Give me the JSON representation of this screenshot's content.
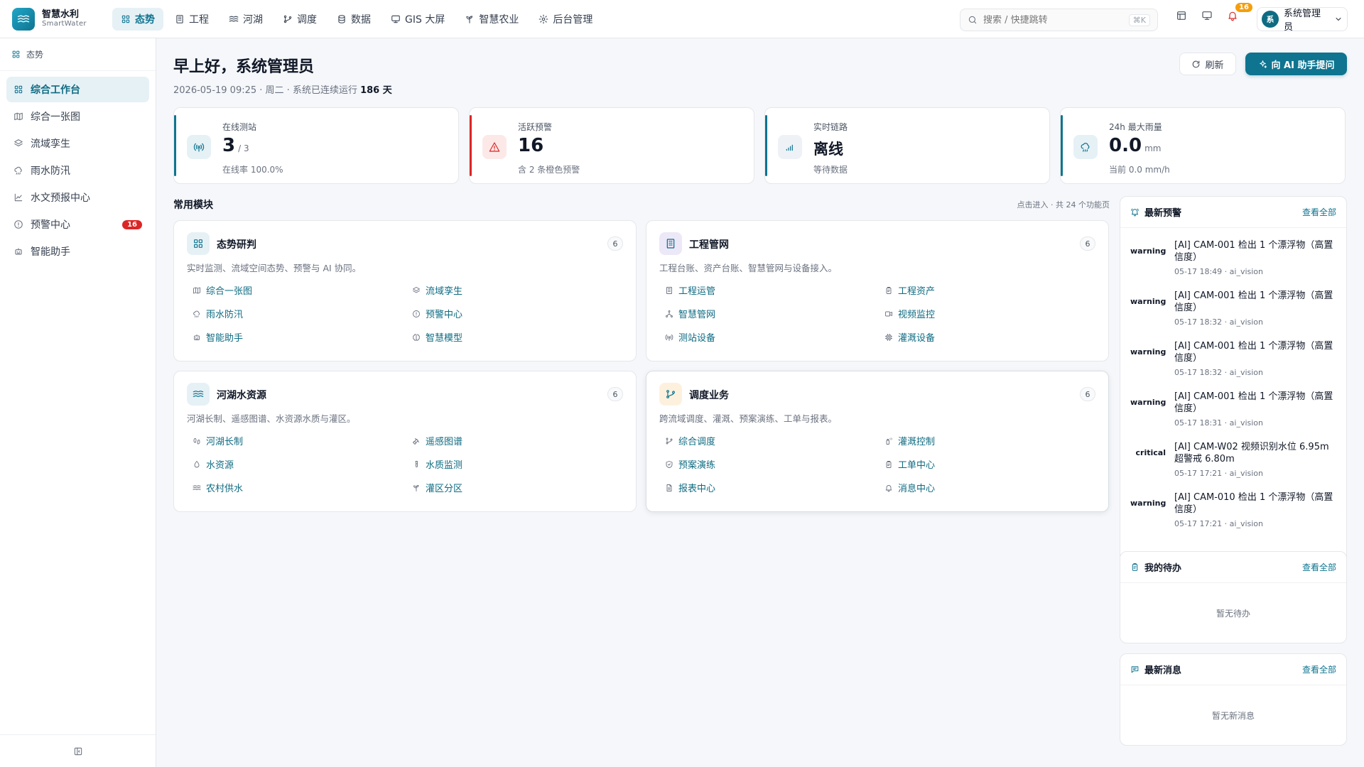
{
  "brand": {
    "name": "智慧水利",
    "sub": "SmartWater"
  },
  "nav": [
    {
      "label": "态势",
      "icon": "grid-icon",
      "active": true
    },
    {
      "label": "工程",
      "icon": "building-icon"
    },
    {
      "label": "河湖",
      "icon": "waves-icon"
    },
    {
      "label": "调度",
      "icon": "git-branch-icon"
    },
    {
      "label": "数据",
      "icon": "database-icon"
    },
    {
      "label": "GIS 大屏",
      "icon": "monitor-icon"
    },
    {
      "label": "智慧农业",
      "icon": "sprout-icon"
    },
    {
      "label": "后台管理",
      "icon": "gear-icon"
    }
  ],
  "search": {
    "placeholder": "搜索 / 快捷跳转",
    "shortcut": "⌘K"
  },
  "topbar": {
    "notification_count": "16",
    "user_avatar": "系",
    "user_name": "系统管理员"
  },
  "sidebar": {
    "header": "态势",
    "items": [
      {
        "label": "综合工作台",
        "icon": "grid-icon",
        "active": true
      },
      {
        "label": "综合一张图",
        "icon": "map-icon"
      },
      {
        "label": "流域孪生",
        "icon": "layers-icon"
      },
      {
        "label": "雨水防汛",
        "icon": "cloud-rain-icon"
      },
      {
        "label": "水文预报中心",
        "icon": "line-chart-icon"
      },
      {
        "label": "预警中心",
        "icon": "alert-circle-icon",
        "badge": "16"
      },
      {
        "label": "智能助手",
        "icon": "bot-icon"
      }
    ]
  },
  "header": {
    "greeting": "早上好，系统管理员",
    "subline_prefix": "2026-05-19 09:25 · 周二 · 系统已连续运行 ",
    "uptime": "186 天",
    "refresh_label": "刷新",
    "ai_label": "向 AI 助手提问"
  },
  "stats": [
    {
      "label": "在线测站",
      "value": "3",
      "unit": "/ 3",
      "sub": "在线率 100.0%",
      "icon": "antenna-icon",
      "accent": "#0e7490",
      "icon_bg": "#e6f1f6",
      "icon_color": "#0e7490"
    },
    {
      "label": "活跃预警",
      "value": "16",
      "unit": "",
      "sub": "含 2 条橙色预警",
      "icon": "warning-triangle-icon",
      "accent": "#dc2626",
      "icon_bg": "#fde8e8",
      "icon_color": "#dc2626"
    },
    {
      "label": "实时链路",
      "value": "离线",
      "unit": "",
      "sub": "等待数据",
      "icon": "signal-icon",
      "accent": "#0e7490",
      "icon_bg": "#eef2f6",
      "icon_color": "#0e7490",
      "text": true
    },
    {
      "label": "24h 最大雨量",
      "value": "0.0",
      "unit": "mm",
      "sub": "当前 0.0 mm/h",
      "icon": "cloud-rain-icon",
      "accent": "#0e7490",
      "icon_bg": "#e6f1f6",
      "icon_color": "#0e7490"
    }
  ],
  "modules_section": {
    "title": "常用模块",
    "hint": "点击进入 · 共 24 个功能页"
  },
  "modules": [
    {
      "title": "态势研判",
      "count": "6",
      "desc": "实时监测、流域空间态势、预警与 AI 协同。",
      "icon": "grid-icon",
      "icon_bg": "#e6f1f6",
      "icon_color": "#0e7490",
      "links": [
        {
          "label": "综合一张图",
          "icon": "map-icon"
        },
        {
          "label": "流域孪生",
          "icon": "layers-icon"
        },
        {
          "label": "雨水防汛",
          "icon": "cloud-rain-icon"
        },
        {
          "label": "预警中心",
          "icon": "alert-circle-icon"
        },
        {
          "label": "智能助手",
          "icon": "bot-icon"
        },
        {
          "label": "智慧模型",
          "icon": "brain-icon"
        }
      ]
    },
    {
      "title": "工程管网",
      "count": "6",
      "desc": "工程台账、资产台账、智慧管网与设备接入。",
      "icon": "building-icon",
      "icon_bg": "#ece8f8",
      "icon_color": "#0e6b82",
      "links": [
        {
          "label": "工程运管",
          "icon": "building-icon"
        },
        {
          "label": "工程资产",
          "icon": "clipboard-icon"
        },
        {
          "label": "智慧管网",
          "icon": "network-icon"
        },
        {
          "label": "视频监控",
          "icon": "video-icon"
        },
        {
          "label": "测站设备",
          "icon": "antenna-icon"
        },
        {
          "label": "灌溉设备",
          "icon": "cpu-icon"
        }
      ]
    },
    {
      "title": "河湖水资源",
      "count": "6",
      "desc": "河湖长制、遥感图谱、水资源水质与灌区。",
      "icon": "waves-icon",
      "icon_bg": "#e6f1f6",
      "icon_color": "#0e7490",
      "links": [
        {
          "label": "河湖长制",
          "icon": "footprints-icon"
        },
        {
          "label": "遥感图谱",
          "icon": "satellite-icon"
        },
        {
          "label": "水资源",
          "icon": "droplet-icon"
        },
        {
          "label": "水质监测",
          "icon": "test-tube-icon"
        },
        {
          "label": "农村供水",
          "icon": "waves-icon"
        },
        {
          "label": "灌区分区",
          "icon": "sprout-icon"
        }
      ]
    },
    {
      "title": "调度业务",
      "count": "6",
      "desc": "跨流域调度、灌溉、预案演练、工单与报表。",
      "icon": "git-branch-icon",
      "icon_bg": "#fdf1de",
      "icon_color": "#0e7490",
      "highlight": true,
      "links": [
        {
          "label": "综合调度",
          "icon": "git-branch-icon"
        },
        {
          "label": "灌溉控制",
          "icon": "spray-icon"
        },
        {
          "label": "预案演练",
          "icon": "shield-icon"
        },
        {
          "label": "工单中心",
          "icon": "clipboard-icon"
        },
        {
          "label": "报表中心",
          "icon": "file-icon"
        },
        {
          "label": "消息中心",
          "icon": "bell-icon"
        }
      ]
    }
  ],
  "alerts_panel": {
    "title": "最新预警",
    "link": "查看全部",
    "items": [
      {
        "level": "warning",
        "title": "[AI] CAM-001 检出 1 个漂浮物（高置信度）",
        "meta": "05-17 18:49 · ai_vision"
      },
      {
        "level": "warning",
        "title": "[AI] CAM-001 检出 1 个漂浮物（高置信度）",
        "meta": "05-17 18:32 · ai_vision"
      },
      {
        "level": "warning",
        "title": "[AI] CAM-001 检出 1 个漂浮物（高置信度）",
        "meta": "05-17 18:32 · ai_vision"
      },
      {
        "level": "warning",
        "title": "[AI] CAM-001 检出 1 个漂浮物（高置信度）",
        "meta": "05-17 18:31 · ai_vision"
      },
      {
        "level": "critical",
        "title": "[AI] CAM-W02 视频识别水位 6.95m 超警戒 6.80m",
        "meta": "05-17 17:21 · ai_vision"
      },
      {
        "level": "warning",
        "title": "[AI] CAM-010 检出 1 个漂浮物（高置信度）",
        "meta": "05-17 17:21 · ai_vision"
      }
    ]
  },
  "todo_panel": {
    "title": "我的待办",
    "link": "查看全部",
    "empty": "暂无待办"
  },
  "messages_panel": {
    "title": "最新消息",
    "link": "查看全部",
    "empty": "暂无新消息"
  }
}
